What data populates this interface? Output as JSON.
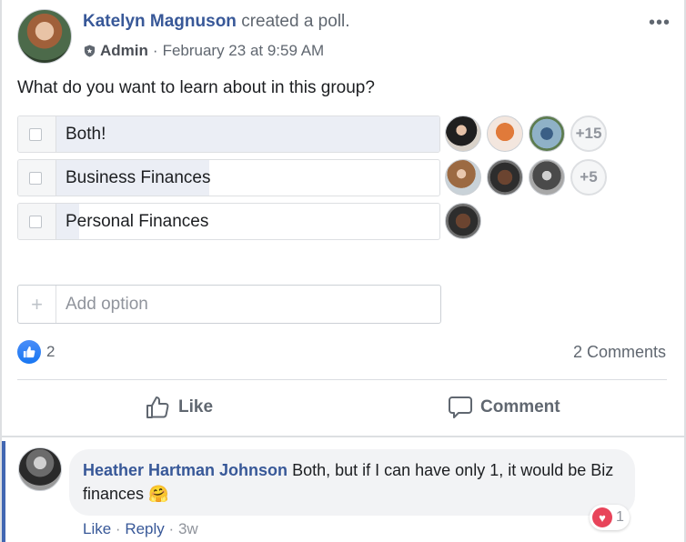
{
  "post": {
    "author": "Katelyn Magnuson",
    "action_text": "created a poll.",
    "badge": "Admin",
    "separator": "·",
    "timestamp": "February 23 at 9:59 AM",
    "more_icon": "•••"
  },
  "poll": {
    "question": "What do you want to learn about in this group?",
    "options": [
      {
        "label": "Both!",
        "vote_share": 1.0,
        "voter_avatars": 3,
        "more_voters": "+15"
      },
      {
        "label": "Business Finances",
        "vote_share": 0.4,
        "voter_avatars": 3,
        "more_voters": "+5"
      },
      {
        "label": "Personal Finances",
        "vote_share": 0.06,
        "voter_avatars": 1,
        "more_voters": ""
      }
    ],
    "add_option_placeholder": "Add option",
    "add_icon": "+"
  },
  "engagement": {
    "like_count": "2",
    "comments_count": "2 Comments"
  },
  "actions": {
    "like": "Like",
    "comment": "Comment"
  },
  "comment": {
    "author": "Heather Hartman Johnson",
    "text": "Both, but if I can have only 1, it would be Biz finances",
    "emoji": "🤗",
    "reaction_count": "1",
    "like": "Like",
    "reply": "Reply",
    "age": "3w",
    "separator": "·"
  },
  "colors": {
    "link_blue": "#385898",
    "like_blue": "#1877f2",
    "love_red": "#e8445a",
    "poll_fill": "#ebeef5"
  }
}
